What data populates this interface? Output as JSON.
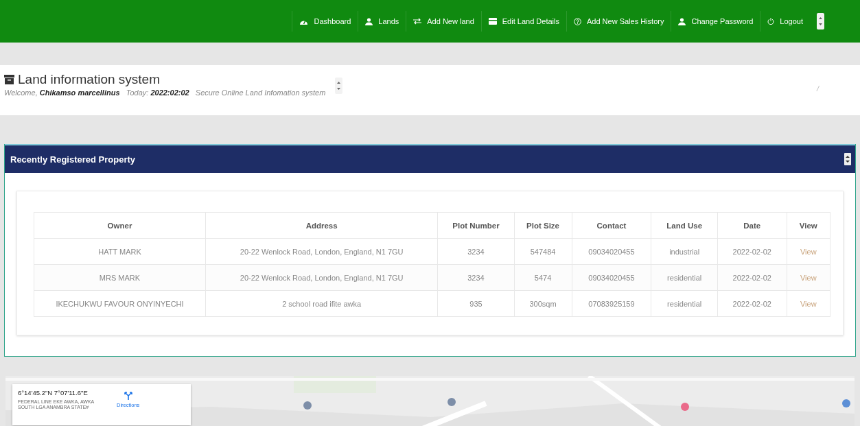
{
  "navbar": {
    "items": [
      {
        "label": "Dashboard"
      },
      {
        "label": "Lands"
      },
      {
        "label": "Add New land"
      },
      {
        "label": "Edit Land Details"
      },
      {
        "label": "Add New Sales History"
      },
      {
        "label": "Change Password"
      },
      {
        "label": "Logout"
      }
    ]
  },
  "header": {
    "title": "Land information system",
    "subtitle": "Welcome, **Chikamso marcellinus**   Today: **2022:02:02**   Secure Online Land Infomation system",
    "breadcrumb": "/"
  },
  "panel": {
    "title": "Recently Registered Property",
    "table": {
      "columns": [
        "Owner",
        "Address",
        "Plot Number",
        "Plot Size",
        "Contact",
        "Land Use",
        "Date",
        "View"
      ],
      "rows": [
        [
          "HATT MARK",
          "20-22 Wenlock Road, London, England, N1 7GU",
          "3234",
          "547484",
          "09034020455",
          "industrial",
          "2022-02-02",
          "View"
        ],
        [
          "MRS MARK",
          "20-22 Wenlock Road, London, England, N1 7GU",
          "3234",
          "5474",
          "09034020455",
          "residential",
          "2022-02-02",
          "View"
        ],
        [
          "IKECHUKWU FAVOUR ONYINYECHI",
          "2 school road ifite awka",
          "935",
          "300sqm",
          "07083925159",
          "residential",
          "2022-02-02",
          "View"
        ]
      ]
    }
  },
  "map": {
    "kind": "picture",
    "info_card": {
      "coordinates": "6°14'45.2\"N 7°07'11.6\"E",
      "address": "FEDERAL LINE EKE AWKA, AWKA SOUTH LGA ANAMBRA STATE#",
      "directions": "Directions"
    }
  }
}
